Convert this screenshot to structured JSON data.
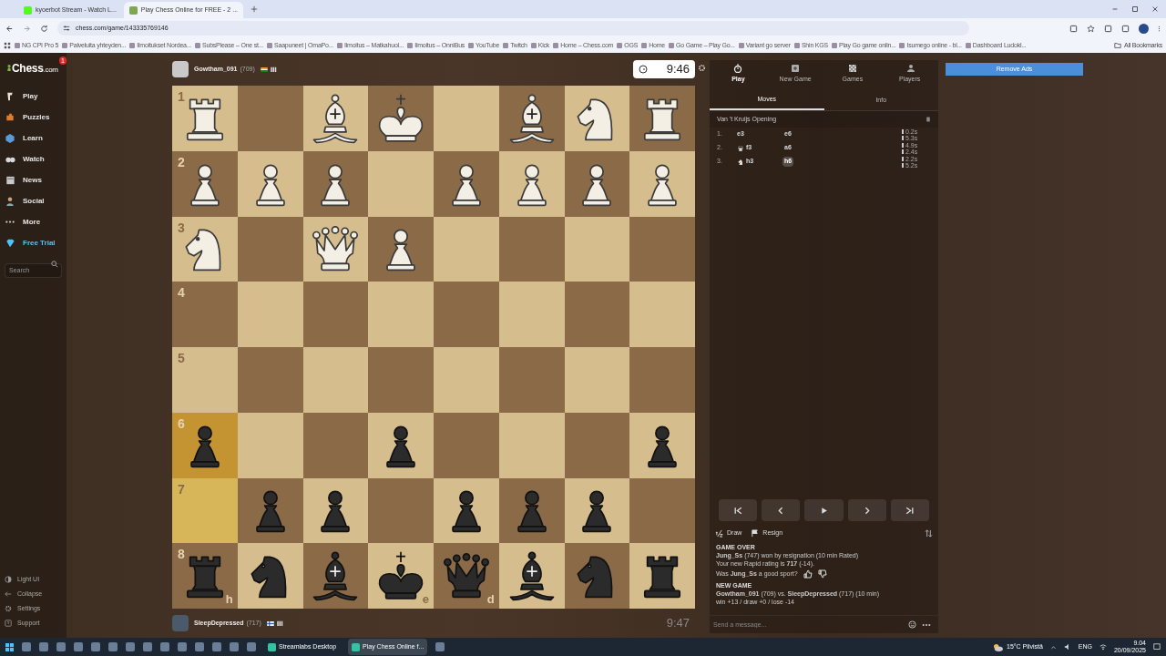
{
  "browser": {
    "tabs": [
      {
        "label": "kyoerbot Stream - Watch L...",
        "selected": false
      },
      {
        "label": "Play Chess Online for FREE - 2 ...",
        "selected": true
      }
    ],
    "url": "chess.com/game/143335769146",
    "bookmarks": [
      "NG CPI Pro 5",
      "Palveluita yhteyden...",
      "Ilmoitukset Nordea...",
      "SubsPlease – One st...",
      "Saapuneet | OmaPo...",
      "Ilmoitus – Matkahuol...",
      "Ilmoitus – OnniBus",
      "YouTube",
      "Twitch",
      "Kick",
      "Home – Chess.com",
      "OGS",
      "Home",
      "Go Game – Play Go...",
      "Variant go server",
      "Shin KGS",
      "Play Go game onlin...",
      "Isumego online - bl...",
      "Dashboard Ludokl..."
    ],
    "all_bookmarks": "All Bookmarks"
  },
  "sidebar": {
    "logo": "Chess",
    "logo_suffix": ".com",
    "notification_badge": "1",
    "items": [
      {
        "label": "Play",
        "kind": "play"
      },
      {
        "label": "Puzzles",
        "kind": "puzzles"
      },
      {
        "label": "Learn",
        "kind": "learn"
      },
      {
        "label": "Watch",
        "kind": "watch"
      },
      {
        "label": "News",
        "kind": "news"
      },
      {
        "label": "Social",
        "kind": "social"
      },
      {
        "label": "More",
        "kind": "more"
      },
      {
        "label": "Free Trial",
        "kind": "trial"
      }
    ],
    "search": {
      "placeholder": "Search"
    },
    "footer": [
      {
        "label": "Light UI",
        "kind": "light"
      },
      {
        "label": "Collapse",
        "kind": "collapse"
      },
      {
        "label": "Settings",
        "kind": "settings"
      },
      {
        "label": "Support",
        "kind": "support"
      }
    ]
  },
  "top_player": {
    "name": "Gowtham_091",
    "rating": "(709)",
    "clock": "9:46",
    "clock_active": true
  },
  "bottom_player": {
    "name": "SleepDepressed",
    "rating": "(717)",
    "clock": "9:47",
    "clock_active": false
  },
  "board": {
    "ranks": [
      {
        "label": "1",
        "squares": [
          {
            "kind": "rook",
            "black": false,
            "highlighted": false
          },
          {
            "kind": "empty",
            "highlighted": false
          },
          {
            "kind": "bishop",
            "black": false,
            "highlighted": false
          },
          {
            "kind": "king",
            "black": false,
            "highlighted": false
          },
          {
            "kind": "empty",
            "highlighted": false
          },
          {
            "kind": "bishop",
            "black": false,
            "highlighted": false
          },
          {
            "kind": "knight",
            "black": false,
            "highlighted": false
          },
          {
            "kind": "rook",
            "black": false,
            "highlighted": false
          }
        ]
      },
      {
        "label": "2",
        "squares": [
          {
            "kind": "pawn",
            "black": false,
            "highlighted": false
          },
          {
            "kind": "pawn",
            "black": false,
            "highlighted": false
          },
          {
            "kind": "pawn",
            "black": false,
            "highlighted": false
          },
          {
            "kind": "empty",
            "highlighted": false
          },
          {
            "kind": "pawn",
            "black": false,
            "highlighted": false
          },
          {
            "kind": "pawn",
            "black": false,
            "highlighted": false
          },
          {
            "kind": "pawn",
            "black": false,
            "highlighted": false
          },
          {
            "kind": "pawn",
            "black": false,
            "highlighted": false
          }
        ]
      },
      {
        "label": "3",
        "squares": [
          {
            "kind": "knight",
            "black": false,
            "highlighted": false
          },
          {
            "kind": "empty",
            "highlighted": false
          },
          {
            "kind": "queen",
            "black": false,
            "highlighted": false
          },
          {
            "kind": "pawn",
            "black": false,
            "highlighted": false
          },
          {
            "kind": "empty",
            "highlighted": false
          },
          {
            "kind": "empty",
            "highlighted": false
          },
          {
            "kind": "empty",
            "highlighted": false
          },
          {
            "kind": "empty",
            "highlighted": false
          }
        ]
      },
      {
        "label": "4",
        "squares": [
          {
            "kind": "empty",
            "highlighted": false
          },
          {
            "kind": "empty",
            "highlighted": false
          },
          {
            "kind": "empty",
            "highlighted": false
          },
          {
            "kind": "empty",
            "highlighted": false
          },
          {
            "kind": "empty",
            "highlighted": false
          },
          {
            "kind": "empty",
            "highlighted": false
          },
          {
            "kind": "empty",
            "highlighted": false
          },
          {
            "kind": "empty",
            "highlighted": false
          }
        ]
      },
      {
        "label": "5",
        "squares": [
          {
            "kind": "empty",
            "highlighted": false
          },
          {
            "kind": "empty",
            "highlighted": false
          },
          {
            "kind": "empty",
            "highlighted": false
          },
          {
            "kind": "empty",
            "highlighted": false
          },
          {
            "kind": "empty",
            "highlighted": false
          },
          {
            "kind": "empty",
            "highlighted": false
          },
          {
            "kind": "empty",
            "highlighted": false
          },
          {
            "kind": "empty",
            "highlighted": false
          }
        ]
      },
      {
        "label": "6",
        "squares": [
          {
            "kind": "pawn",
            "black": true,
            "highlighted": true
          },
          {
            "kind": "empty",
            "highlighted": false
          },
          {
            "kind": "empty",
            "highlighted": false
          },
          {
            "kind": "pawn",
            "black": true,
            "highlighted": false
          },
          {
            "kind": "empty",
            "highlighted": false
          },
          {
            "kind": "empty",
            "highlighted": false
          },
          {
            "kind": "empty",
            "highlighted": false
          },
          {
            "kind": "pawn",
            "black": true,
            "highlighted": false
          }
        ]
      },
      {
        "label": "7",
        "squares": [
          {
            "kind": "empty",
            "highlighted": true
          },
          {
            "kind": "pawn",
            "black": true,
            "highlighted": false
          },
          {
            "kind": "pawn",
            "black": true,
            "highlighted": false
          },
          {
            "kind": "empty",
            "highlighted": false
          },
          {
            "kind": "pawn",
            "black": true,
            "highlighted": false
          },
          {
            "kind": "pawn",
            "black": true,
            "highlighted": false
          },
          {
            "kind": "pawn",
            "black": true,
            "highlighted": false
          },
          {
            "kind": "empty",
            "highlighted": false
          }
        ]
      },
      {
        "label": "8",
        "squares": [
          {
            "kind": "rook",
            "black": true,
            "highlighted": false,
            "file_label": "h"
          },
          {
            "kind": "knight",
            "black": true,
            "highlighted": false
          },
          {
            "kind": "bishop",
            "black": true,
            "highlighted": false
          },
          {
            "kind": "king",
            "black": true,
            "highlighted": false,
            "file_label": "e"
          },
          {
            "kind": "queen",
            "black": true,
            "highlighted": false,
            "file_label": "d"
          },
          {
            "kind": "bishop",
            "black": true,
            "highlighted": false
          },
          {
            "kind": "knight",
            "black": true,
            "highlighted": false
          },
          {
            "kind": "rook",
            "black": true,
            "highlighted": false
          }
        ]
      }
    ]
  },
  "nav": [
    {
      "label": "Play",
      "kind": "play",
      "selected": true
    },
    {
      "label": "New Game",
      "kind": "new",
      "selected": false
    },
    {
      "label": "Games",
      "kind": "games",
      "selected": false
    },
    {
      "label": "Players",
      "kind": "players",
      "selected": false
    }
  ],
  "panel_tabs": [
    {
      "label": "Moves",
      "selected": true
    },
    {
      "label": "Info",
      "selected": false
    }
  ],
  "opening": "Van 't Kruijs Opening",
  "moves": [
    {
      "number": "1.",
      "white": {
        "san": "e3",
        "selected": false
      },
      "black": {
        "san": "e6",
        "selected": false
      },
      "times": [
        "0.2s",
        "5.3s"
      ]
    },
    {
      "number": "2.",
      "white": {
        "san": "f3",
        "kind": "queen",
        "selected": false
      },
      "black": {
        "san": "a6",
        "selected": false
      },
      "times": [
        "4.9s",
        "2.4s"
      ]
    },
    {
      "number": "3.",
      "white": {
        "san": "h3",
        "kind": "knight",
        "selected": false
      },
      "black": {
        "san": "h6",
        "selected": true
      },
      "times": [
        "2.2s",
        "5.2s"
      ]
    }
  ],
  "controls": [
    {
      "kind": "first"
    },
    {
      "kind": "prev"
    },
    {
      "kind": "play"
    },
    {
      "kind": "next"
    },
    {
      "kind": "last"
    }
  ],
  "actions": [
    {
      "label": "Draw",
      "kind": "draw"
    },
    {
      "label": "Resign",
      "kind": "resign"
    }
  ],
  "chat": [
    {
      "kind": "heading",
      "text": "GAME OVER"
    },
    {
      "kind": "line",
      "text": "**Jung_Ss** (747) won by resignation (10 min Rated)"
    },
    {
      "kind": "line",
      "text": "Your new Rapid rating is **717** (-14)."
    },
    {
      "kind": "feedback",
      "text": "Was **Jung_Ss** a good sport?"
    },
    {
      "kind": "heading",
      "text": "NEW GAME"
    },
    {
      "kind": "line",
      "text": "**Gowtham_091** (709) vs. **SleepDepressed** (717) (10 min)"
    },
    {
      "kind": "line",
      "text": "win +13 / draw +0 / lose -14"
    }
  ],
  "message": {
    "placeholder": "Send a message..."
  },
  "remove_ads": "Remove Ads",
  "taskbar": {
    "apps": [
      {
        "label": "Streamlabs Desktop",
        "selected": false
      },
      {
        "label": "Play Chess Online f...",
        "selected": true
      }
    ],
    "weather": "15°C Pilvistä",
    "language": "ENG",
    "time": "9.04",
    "date": "20/09/2025"
  }
}
